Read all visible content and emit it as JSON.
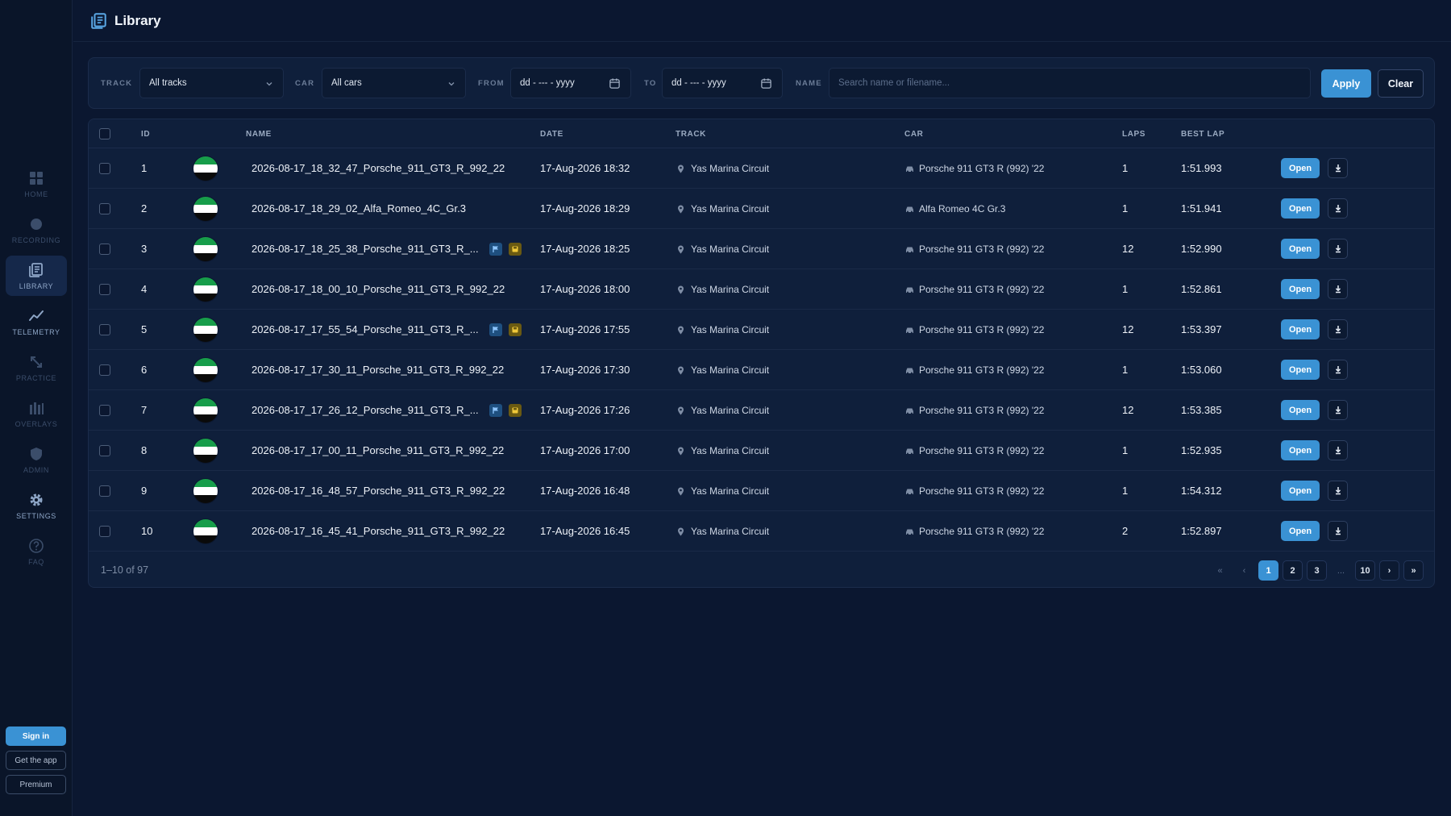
{
  "nav": {
    "items": [
      {
        "label": "HOME",
        "icon": "grid-icon",
        "active": false
      },
      {
        "label": "RECORDING",
        "icon": "record-dot-icon",
        "active": false
      },
      {
        "label": "LIBRARY",
        "icon": "library-icon",
        "active": true
      },
      {
        "label": "TELEMETRY",
        "icon": "line-chart-icon",
        "active": false
      },
      {
        "label": "PRACTICE",
        "icon": "arrows-icon",
        "active": false
      },
      {
        "label": "OVERLAYS",
        "icon": "bars-icon",
        "active": false
      },
      {
        "label": "ADMIN",
        "icon": "shield-icon",
        "active": false
      },
      {
        "label": "SETTINGS",
        "icon": "gear-icon",
        "active": false
      },
      {
        "label": "FAQ",
        "icon": "question-icon",
        "active": false
      }
    ],
    "sign_in": "Sign in",
    "get_app": "Get the app",
    "premium": "Premium"
  },
  "header": {
    "title": "Library"
  },
  "filters": {
    "track_label": "TRACK",
    "track_value": "All tracks",
    "car_label": "CAR",
    "car_value": "All cars",
    "from_label": "FROM",
    "from_value": "dd - --- - yyyy",
    "to_label": "TO",
    "to_value": "dd - --- - yyyy",
    "name_label": "NAME",
    "name_placeholder": "Search name or filename...",
    "apply": "Apply",
    "clear": "Clear"
  },
  "table": {
    "headers": {
      "id": "ID",
      "name": "NAME",
      "date": "DATE",
      "track": "TRACK",
      "car": "CAR",
      "laps": "LAPS",
      "best_lap": "BEST LAP"
    },
    "open_label": "Open",
    "rows": [
      {
        "id": "1",
        "name": "2026-08-17_18_32_47_Porsche_911_GT3_R_992_22",
        "date": "17-Aug-2026 18:32",
        "track": "Yas Marina Circuit",
        "car": "Porsche 911 GT3 R (992) '22",
        "laps": "1",
        "best_lap": "1:51.993",
        "tags": false
      },
      {
        "id": "2",
        "name": "2026-08-17_18_29_02_Alfa_Romeo_4C_Gr.3",
        "date": "17-Aug-2026 18:29",
        "track": "Yas Marina Circuit",
        "car": "Alfa Romeo 4C Gr.3",
        "laps": "1",
        "best_lap": "1:51.941",
        "tags": false
      },
      {
        "id": "3",
        "name": "2026-08-17_18_25_38_Porsche_911_GT3_R_...",
        "date": "17-Aug-2026 18:25",
        "track": "Yas Marina Circuit",
        "car": "Porsche 911 GT3 R (992) '22",
        "laps": "12",
        "best_lap": "1:52.990",
        "tags": true
      },
      {
        "id": "4",
        "name": "2026-08-17_18_00_10_Porsche_911_GT3_R_992_22",
        "date": "17-Aug-2026 18:00",
        "track": "Yas Marina Circuit",
        "car": "Porsche 911 GT3 R (992) '22",
        "laps": "1",
        "best_lap": "1:52.861",
        "tags": false
      },
      {
        "id": "5",
        "name": "2026-08-17_17_55_54_Porsche_911_GT3_R_...",
        "date": "17-Aug-2026 17:55",
        "track": "Yas Marina Circuit",
        "car": "Porsche 911 GT3 R (992) '22",
        "laps": "12",
        "best_lap": "1:53.397",
        "tags": true
      },
      {
        "id": "6",
        "name": "2026-08-17_17_30_11_Porsche_911_GT3_R_992_22",
        "date": "17-Aug-2026 17:30",
        "track": "Yas Marina Circuit",
        "car": "Porsche 911 GT3 R (992) '22",
        "laps": "1",
        "best_lap": "1:53.060",
        "tags": false
      },
      {
        "id": "7",
        "name": "2026-08-17_17_26_12_Porsche_911_GT3_R_...",
        "date": "17-Aug-2026 17:26",
        "track": "Yas Marina Circuit",
        "car": "Porsche 911 GT3 R (992) '22",
        "laps": "12",
        "best_lap": "1:53.385",
        "tags": true
      },
      {
        "id": "8",
        "name": "2026-08-17_17_00_11_Porsche_911_GT3_R_992_22",
        "date": "17-Aug-2026 17:00",
        "track": "Yas Marina Circuit",
        "car": "Porsche 911 GT3 R (992) '22",
        "laps": "1",
        "best_lap": "1:52.935",
        "tags": false
      },
      {
        "id": "9",
        "name": "2026-08-17_16_48_57_Porsche_911_GT3_R_992_22",
        "date": "17-Aug-2026 16:48",
        "track": "Yas Marina Circuit",
        "car": "Porsche 911 GT3 R (992) '22",
        "laps": "1",
        "best_lap": "1:54.312",
        "tags": false
      },
      {
        "id": "10",
        "name": "2026-08-17_16_45_41_Porsche_911_GT3_R_992_22",
        "date": "17-Aug-2026 16:45",
        "track": "Yas Marina Circuit",
        "car": "Porsche 911 GT3 R (992) '22",
        "laps": "2",
        "best_lap": "1:52.897",
        "tags": false
      }
    ]
  },
  "pagination": {
    "count": "1–10 of 97",
    "first": "«",
    "prev": "‹",
    "pages": [
      "1",
      "2",
      "3"
    ],
    "ellipsis": "...",
    "last_page": "10",
    "next": "›",
    "last": "»",
    "current": "1"
  },
  "colors": {
    "background": "#0b1730",
    "panel": "#0f1f3b",
    "accent": "#3a92d4"
  }
}
